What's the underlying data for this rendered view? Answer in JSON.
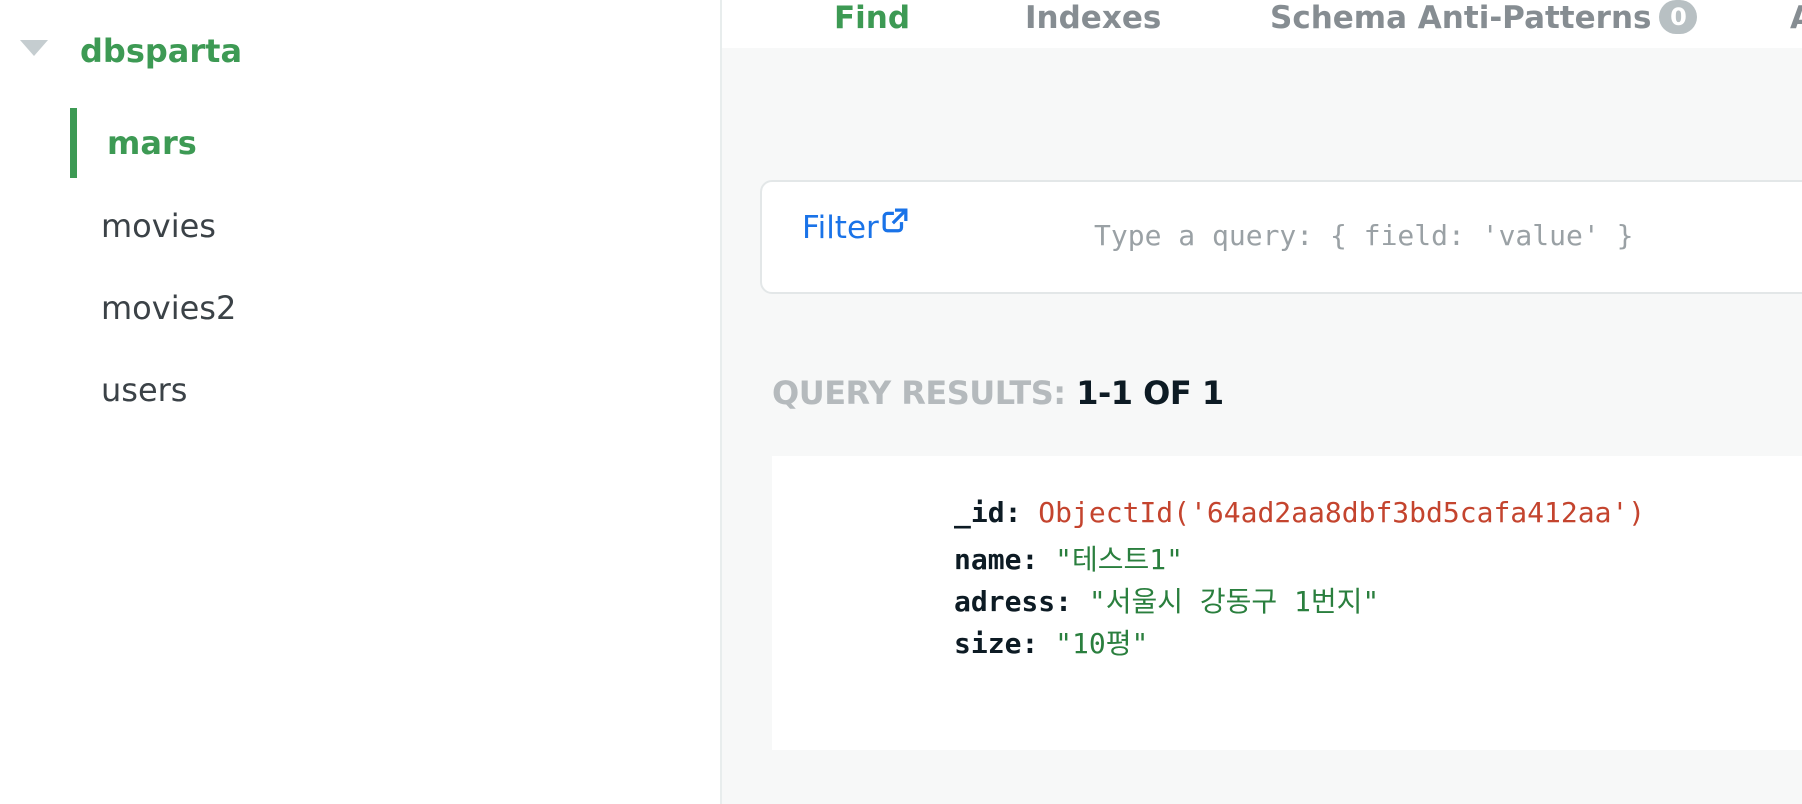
{
  "sidebar": {
    "database": "dbsparta",
    "collections": [
      {
        "label": "mars",
        "active": true
      },
      {
        "label": "movies",
        "active": false
      },
      {
        "label": "movies2",
        "active": false
      },
      {
        "label": "users",
        "active": false
      }
    ]
  },
  "tabs": [
    {
      "label": "Find",
      "active": true
    },
    {
      "label": "Indexes",
      "active": false
    },
    {
      "label": "Schema Anti-Patterns",
      "badge": "0",
      "active": false
    },
    {
      "label": "A",
      "active": false
    }
  ],
  "filter": {
    "label": "Filter",
    "placeholder": "Type a query: { field: 'value' }",
    "value": ""
  },
  "results": {
    "label": "QUERY RESULTS:",
    "range": "1-1 OF 1"
  },
  "document": {
    "fields": [
      {
        "key": "_id",
        "value": "ObjectId('64ad2aa8dbf3bd5cafa412aa')",
        "type": "oid"
      },
      {
        "key": "name",
        "value": "\"테스트1\"",
        "type": "str"
      },
      {
        "key": "adress",
        "value": "\"서울시 강동구 1번지\"",
        "type": "str"
      },
      {
        "key": "size",
        "value": "\"10평\"",
        "type": "str"
      }
    ]
  },
  "colors": {
    "accent_green": "#3d9a54",
    "link_blue": "#1a73e8",
    "objectid_red": "#c4442e",
    "string_green": "#2a7f3e"
  }
}
